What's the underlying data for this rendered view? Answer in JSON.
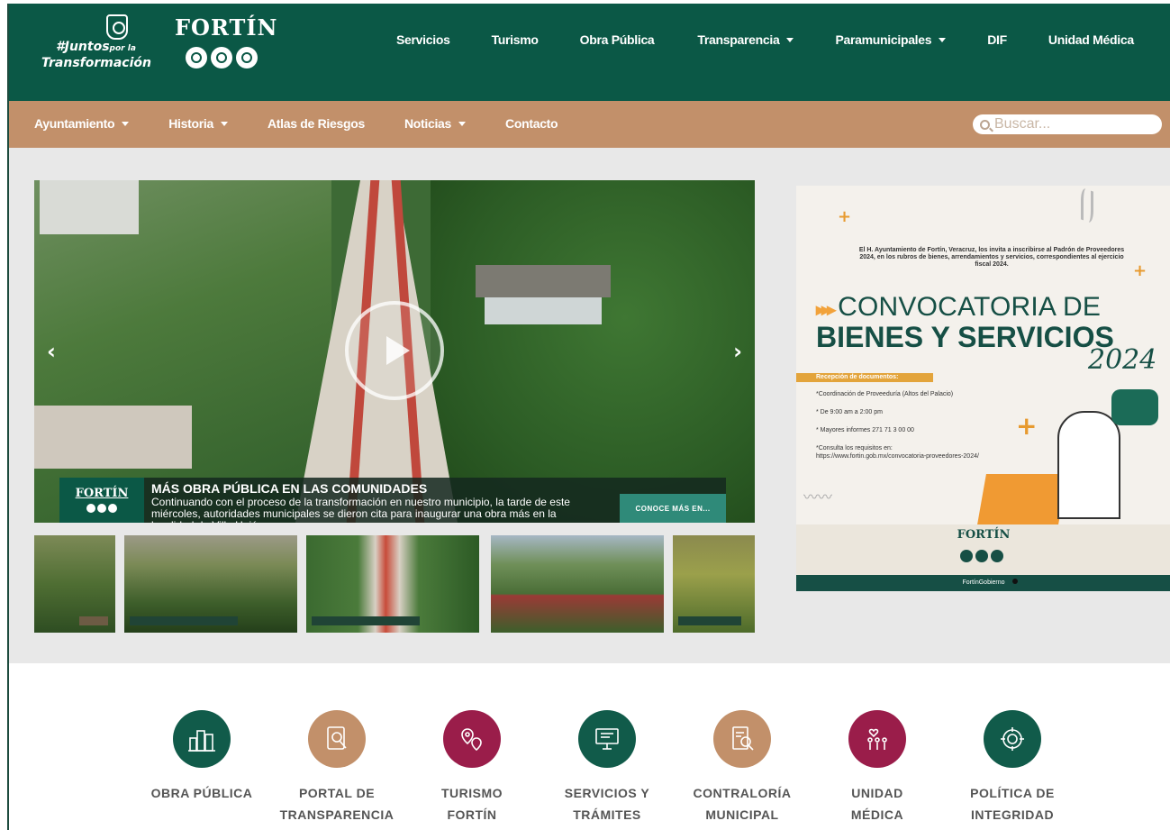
{
  "header": {
    "slogan_line1": "#Juntos",
    "slogan_small": "por la",
    "slogan_line2": "Transformación",
    "brand": "FORTÍN",
    "nav": [
      {
        "label": "Servicios",
        "dropdown": false
      },
      {
        "label": "Turismo",
        "dropdown": false
      },
      {
        "label": "Obra Pública",
        "dropdown": false
      },
      {
        "label": "Transparencia",
        "dropdown": true
      },
      {
        "label": "Paramunicipales",
        "dropdown": true
      },
      {
        "label": "DIF",
        "dropdown": false
      },
      {
        "label": "Unidad Médica",
        "dropdown": false
      }
    ]
  },
  "subnav": {
    "items": [
      {
        "label": "Ayuntamiento",
        "dropdown": true
      },
      {
        "label": "Historia",
        "dropdown": true
      },
      {
        "label": "Atlas de Riesgos",
        "dropdown": false
      },
      {
        "label": "Noticias",
        "dropdown": true
      },
      {
        "label": "Contacto",
        "dropdown": false
      }
    ],
    "search_placeholder": "Buscar..."
  },
  "hero": {
    "logo": "FORTÍN",
    "title": "MÁS OBRA PÚBLICA EN LAS COMUNIDADES",
    "text": "Continuando con el proceso de la transformación en nuestro municipio, la tarde de este miércoles, autoridades municipales se dieron cita para inaugurar una obra más en la localidad de Villa Unión",
    "cta": "CONOCE MÁS EN...",
    "prev_arrow": "‹",
    "next_arrow": "›"
  },
  "ad": {
    "intro": "El H. Ayuntamiento de Fortín, Veracruz, los invita a inscribirse al Padrón de Proveedores 2024, en los rubros de bienes, arrendamientos y servicios, correspondientes al ejercicio fiscal 2024.",
    "convocatoria": "CONVOCATORIA DE",
    "bienes": "BIENES Y SERVICIOS",
    "year": "2024",
    "reception_label": "Recepción de documentos:",
    "lines": [
      "*Coordinación de Proveeduría (Altos del Palacio)",
      "* De 9:00 am a 2:00 pm",
      "* Mayores informes 271 71 3 00 00",
      "*Consulta los requisitos en:",
      "https://www.fortin.gob.mx/convocatoria-proveedores-2024/"
    ],
    "brand": "FORTÍN",
    "social": "FortínGobierno",
    "chevrons": "▸▸▸",
    "wave": "〰〰",
    "plus": "+"
  },
  "quicklinks": [
    {
      "line1": "OBRA PÚBLICA",
      "line2": "",
      "color": "#115b4a",
      "icon": "city-icon"
    },
    {
      "line1": "PORTAL DE",
      "line2": "TRANSPARENCIA",
      "color": "#c2906a",
      "icon": "document-search-icon"
    },
    {
      "line1": "TURISMO",
      "line2": "FORTÍN",
      "color": "#9a1d4a",
      "icon": "map-pin-icon"
    },
    {
      "line1": "SERVICIOS Y",
      "line2": "TRÁMITES",
      "color": "#115b4a",
      "icon": "computer-icon"
    },
    {
      "line1": "CONTRALORÍA",
      "line2": "MUNICIPAL",
      "color": "#c2906a",
      "icon": "audit-icon"
    },
    {
      "line1": "UNIDAD",
      "line2": "MÉDICA",
      "color": "#9a1d4a",
      "icon": "medical-people-icon"
    },
    {
      "line1": "POLÍTICA DE",
      "line2": "INTEGRIDAD",
      "color": "#115b4a",
      "icon": "integrity-icon"
    }
  ]
}
